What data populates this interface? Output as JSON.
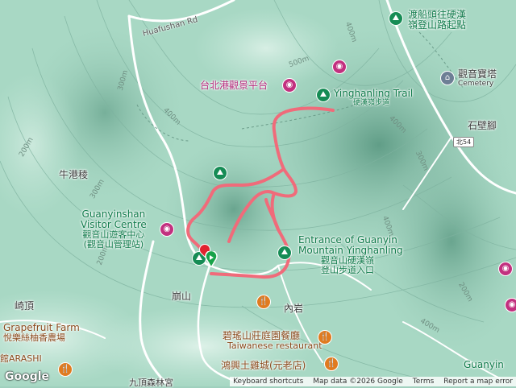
{
  "roads": {
    "huafushan": "Huafushan Rd",
    "north54": "北54"
  },
  "contours": [
    "300m",
    "400m",
    "500m",
    "400m",
    "200m",
    "300m",
    "300m",
    "400m",
    "200m",
    "400m",
    "200m",
    "400m"
  ],
  "places": {
    "ferry_trailhead_line1": "渡船頭往硬漢",
    "ferry_trailhead_line2": "嶺登山路起點",
    "taipei_port_view": "台北港觀景平台",
    "yinghanling_trail_en": "Yinghanling Trail",
    "yinghanling_trail_zh": "硬漢嶺步道",
    "cemetery_zh": "觀音寶塔",
    "cemetery_en": "Cemetery",
    "shibijiao": "石壁腳",
    "niugangling": "牛港稜",
    "visitor_centre_en1": "Guanyinshan",
    "visitor_centre_en2": "Visitor Centre",
    "visitor_centre_zh1": "觀音山遊客中心",
    "visitor_centre_zh2": "(觀音山管理站)",
    "entrance_en1": "Entrance of Guanyin",
    "entrance_en2": "Mountain Yinghanling",
    "entrance_zh1": "觀音山硬漢嶺",
    "entrance_zh2": "登山步道入口",
    "pengshan": "崩山",
    "neiyan": "內岩",
    "qiding": "崎頂",
    "grapefruit_en": "Grapefruit Farm",
    "grapefruit_zh": "悅樂絲柚香農場",
    "bitashan_zh": "碧瑤山莊庭園餐廳",
    "bitashan_en": "Taiwanese restaurant",
    "hongxing": "鴻興土雞城(元老店)",
    "arashi": "館ARASHI",
    "guanyin_bottom": "Guanyin",
    "bottom_partial": "九頂森林宮"
  },
  "icons": {
    "trail": "hiking-icon",
    "attraction": "camera-icon",
    "restaurant": "fork-knife-icon",
    "temple": "temple-icon"
  },
  "colors": {
    "route": "#f06b7a",
    "green_label": "#0f7a4a",
    "pink_label": "#b3277a"
  },
  "attribution": {
    "logo": "Google",
    "keyboard": "Keyboard shortcuts",
    "mapdata": "Map data ©2026 Google",
    "terms": "Terms",
    "report": "Report a map error"
  }
}
